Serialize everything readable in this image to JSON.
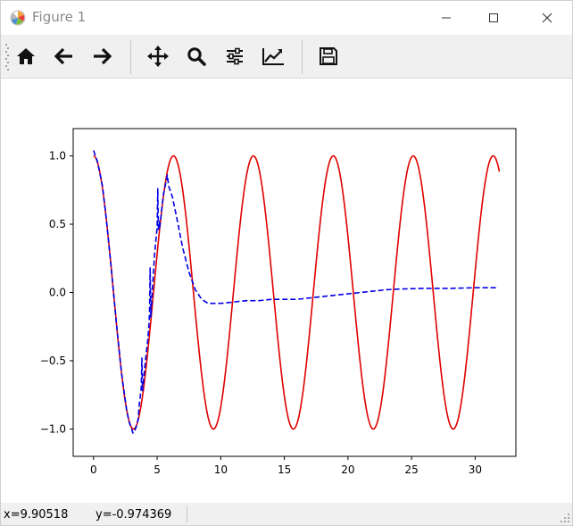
{
  "window": {
    "title": "Figure 1"
  },
  "toolbar": {
    "buttons": [
      {
        "name": "home-button",
        "icon": "home-icon"
      },
      {
        "name": "back-button",
        "icon": "arrow-left-icon"
      },
      {
        "name": "forward-button",
        "icon": "arrow-right-icon"
      },
      {
        "name": "pan-button",
        "icon": "move-icon"
      },
      {
        "name": "zoom-button",
        "icon": "magnifier-icon"
      },
      {
        "name": "subplots-button",
        "icon": "sliders-icon"
      },
      {
        "name": "edit-axes-button",
        "icon": "line-chart-icon"
      },
      {
        "name": "save-button",
        "icon": "floppy-disk-icon"
      }
    ]
  },
  "status": {
    "x_text": "x=9.90518",
    "y_text": "y=-0.974369"
  },
  "chart_data": {
    "type": "line",
    "title": "",
    "xlabel": "",
    "ylabel": "",
    "xlim": [
      -1.6,
      33.2
    ],
    "ylim": [
      -1.2,
      1.2
    ],
    "xticks": [
      0,
      5,
      10,
      15,
      20,
      25,
      30
    ],
    "yticks": [
      -1.0,
      -0.5,
      0.0,
      0.5,
      1.0
    ],
    "ytick_labels": [
      "−1.0",
      "−0.5",
      "0.0",
      "0.5",
      "1.0"
    ],
    "grid": false,
    "series": [
      {
        "style": "solid",
        "color": "#e00000",
        "function": "cos",
        "x_range": [
          0,
          31.9
        ]
      },
      {
        "style": "dashed",
        "color": "#0000e6",
        "x": [
          0,
          0.3,
          0.7,
          1.0,
          1.4,
          1.8,
          2.2,
          2.6,
          2.8,
          3.0,
          3.1,
          3.3,
          3.5,
          3.6,
          3.75,
          3.8,
          3.85,
          3.95,
          4.1,
          4.25,
          4.35,
          4.4,
          4.45,
          4.5,
          4.55,
          4.65,
          4.8,
          5.0,
          5.05,
          5.1,
          5.15,
          5.2,
          5.35,
          5.5,
          5.7,
          5.8,
          5.9,
          6.2,
          6.6,
          7.0,
          7.5,
          8.0,
          8.5,
          9.0,
          9.5,
          10.0,
          11.0,
          12.0,
          13.0,
          14.0,
          15.0,
          16.0,
          17.0,
          18.0,
          19.0,
          20.0,
          21.0,
          22.0,
          23.0,
          24.0,
          26.0,
          28.0,
          30.0,
          31.8
        ],
        "y": [
          1.04,
          0.96,
          0.78,
          0.54,
          0.17,
          -0.23,
          -0.59,
          -0.86,
          -0.95,
          -1.0,
          -1.03,
          -1.0,
          -0.93,
          -0.82,
          -0.7,
          -0.48,
          -0.72,
          -0.62,
          -0.48,
          -0.36,
          -0.25,
          -0.15,
          0.18,
          -0.18,
          -0.1,
          0.06,
          0.28,
          0.48,
          0.76,
          0.45,
          0.52,
          0.47,
          0.6,
          0.72,
          0.81,
          0.86,
          0.78,
          0.7,
          0.52,
          0.33,
          0.15,
          0.02,
          -0.05,
          -0.08,
          -0.08,
          -0.08,
          -0.07,
          -0.06,
          -0.06,
          -0.05,
          -0.05,
          -0.05,
          -0.04,
          -0.03,
          -0.02,
          -0.01,
          0.0,
          0.01,
          0.02,
          0.025,
          0.03,
          0.03,
          0.035,
          0.035
        ]
      }
    ]
  }
}
